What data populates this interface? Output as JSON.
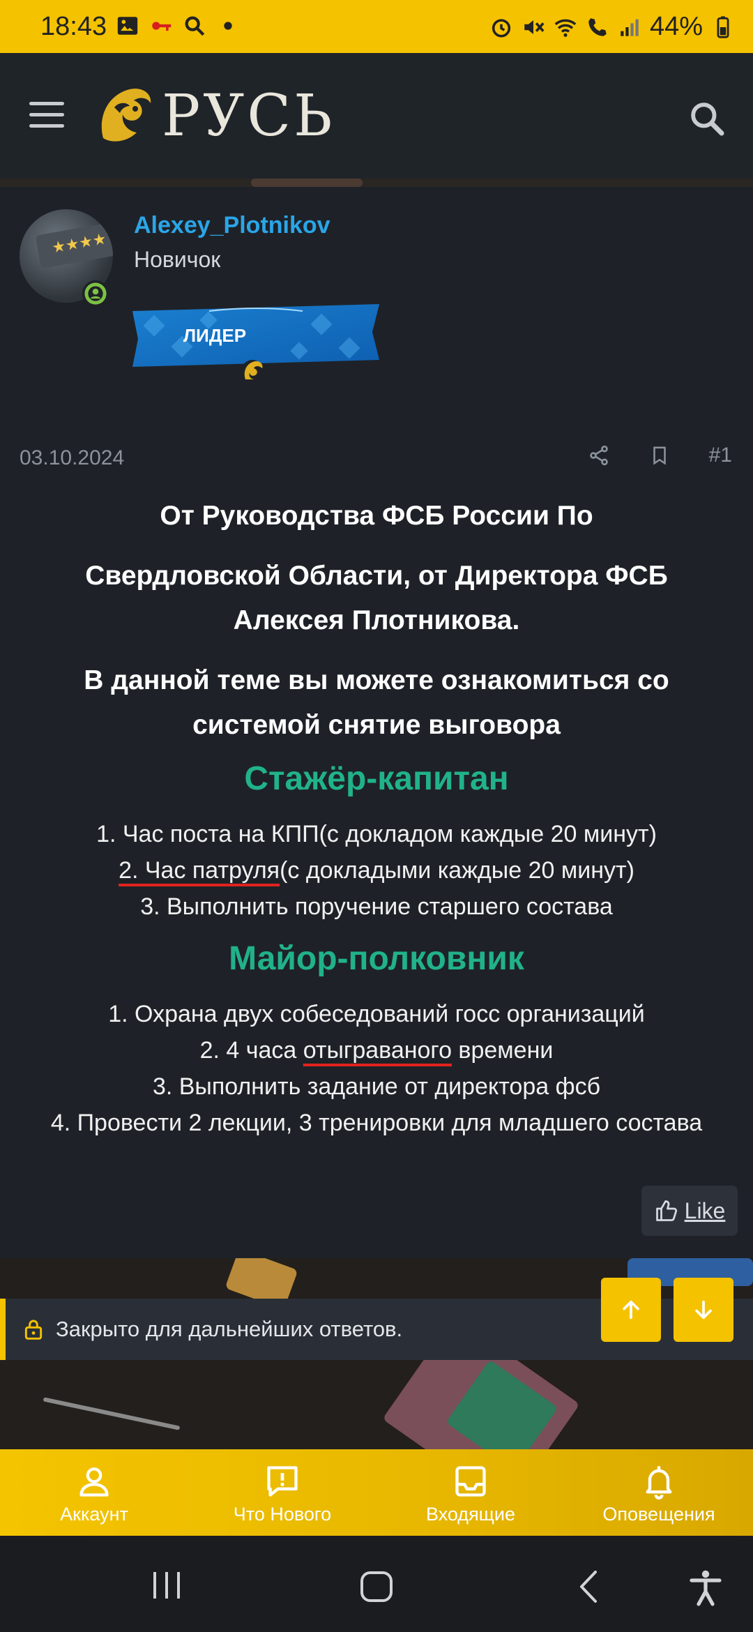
{
  "status_bar": {
    "time": "18:43",
    "battery": "44%"
  },
  "header": {
    "logo_text": "РУСЬ"
  },
  "post": {
    "username": "Alexey_Plotnikov",
    "user_title": "Новичок",
    "banner_label": "ЛИДЕР",
    "date": "03.10.2024",
    "post_number": "#1",
    "intro_line_1": "От Руководства ФСБ России По",
    "intro_line_2": "Свердловской Области, от Директора ФСБ",
    "intro_line_3": "Алексея Плотникова.",
    "topic_line_1": "В данной теме вы можете ознакомиться со",
    "topic_line_2": "системой снятие выговора",
    "section_1": {
      "title": "Стажёр-капитан",
      "item_1": "1. Час поста на КПП(с докладом каждые 20 минут)",
      "item_2_underlined": "2. Час патруля",
      "item_2_rest": "(с докладыми каждые 20 минут)",
      "item_3": "3. Выполнить поручение старшего состава"
    },
    "section_2": {
      "title": "Майор-полковник",
      "item_1": "1. Охрана двух собеседований госс организаций",
      "item_2_start": "2. 4 часа ",
      "item_2_underlined": "отыграваного",
      "item_2_end": " времени",
      "item_3": "3. Выполнить задание от директора фсб",
      "item_4": "4. Провести 2 лекции, 3 тренировки для младшего состава"
    },
    "like_label": "Like"
  },
  "closed_notice": "Закрыто для дальнейших ответов.",
  "bottom_nav": {
    "account": "Аккаунт",
    "whats_new": "Что Нового",
    "inbox": "Входящие",
    "alerts": "Оповещения"
  },
  "colors": {
    "accent": "#f5c200",
    "username": "#2aa6e8",
    "section_title": "#21b28a",
    "background": "#1e2228"
  },
  "icons": [
    "menu-icon",
    "search-icon",
    "share-icon",
    "bookmark-icon",
    "like-icon",
    "lock-icon",
    "arrow-up-icon",
    "arrow-down-icon",
    "user-icon",
    "chat-alert-icon",
    "inbox-icon",
    "bell-icon"
  ]
}
